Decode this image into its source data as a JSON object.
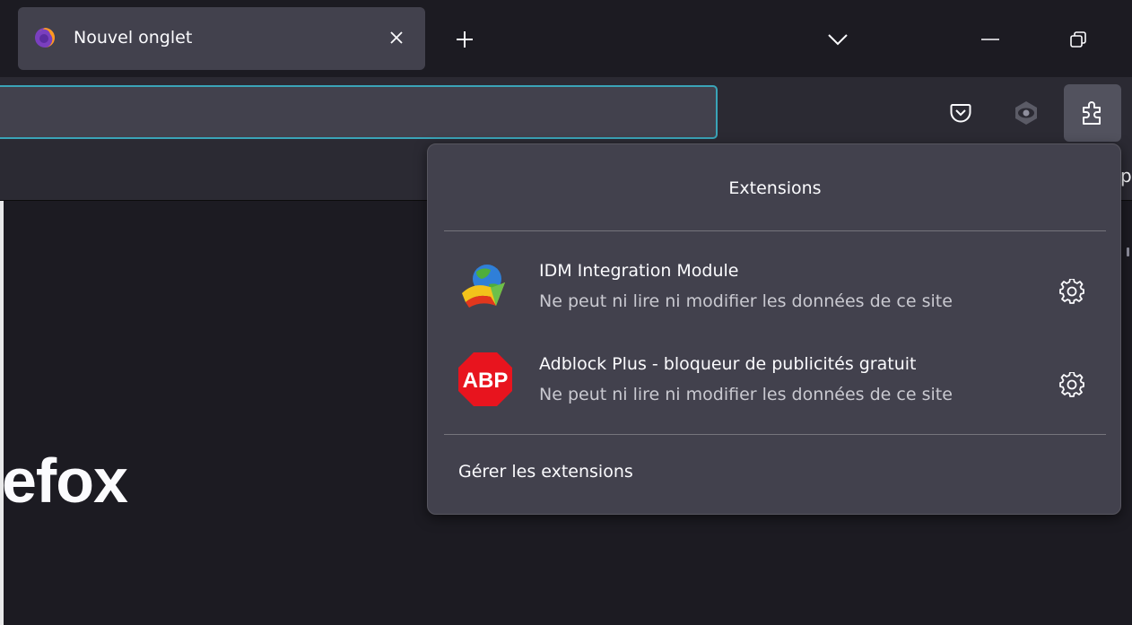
{
  "tab": {
    "title": "Nouvel onglet"
  },
  "url": {
    "value": ""
  },
  "page": {
    "brand_fragment": "efox"
  },
  "bookmarks": {
    "edge_text": "p"
  },
  "extensions_panel": {
    "title": "Extensions",
    "items": [
      {
        "name": "IDM Integration Module",
        "status": "Ne peut ni lire ni modifier les données de ce site",
        "icon": "idm-globe-icon"
      },
      {
        "name": "Adblock Plus - bloqueur de publicités gratuit",
        "status": "Ne peut ni lire ni modifier les données de ce site",
        "icon": "abp-stop-icon",
        "icon_text": "ABP"
      }
    ],
    "manage_label": "Gérer les extensions"
  },
  "colors": {
    "accent_focus": "#3aa4b8",
    "panel_bg": "#42414d",
    "toolbar_bg": "#2b2a33",
    "abp_red": "#e8141e"
  }
}
